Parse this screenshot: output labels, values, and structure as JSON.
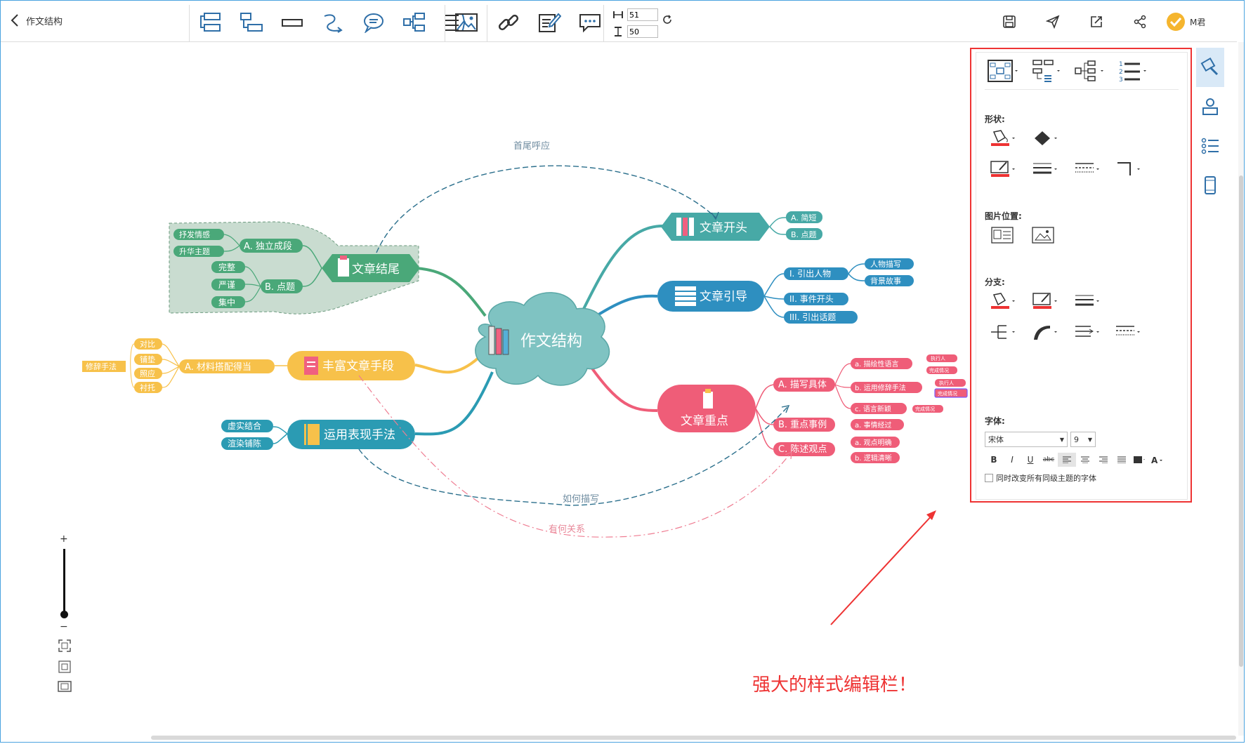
{
  "header": {
    "back_label": "作文结构",
    "zoom_width": "51",
    "zoom_height": "50",
    "user_name": "M君"
  },
  "toolbar_icons": [
    "sibling-topic-icon",
    "child-topic-icon",
    "floating-topic-icon",
    "relationship-icon",
    "callout-icon",
    "summary-icon",
    "boundary-icon",
    "image-icon",
    "link-icon",
    "note-icon",
    "comment-icon"
  ],
  "mindmap": {
    "center": "作文结构",
    "branches": {
      "opening": {
        "title": "文章开头",
        "children": [
          "A. 简短",
          "B. 点题"
        ]
      },
      "intro": {
        "title": "文章引导",
        "children": [
          "I. 引出人物",
          "II. 事件开头",
          "III. 引出话题"
        ],
        "sub": [
          "人物描写",
          "背景故事"
        ]
      },
      "focus": {
        "title": "文章重点",
        "children": [
          "A. 描写具体",
          "B. 重点事例",
          "C. 陈述观点"
        ],
        "desc": [
          "a. 描绘性语言",
          "b. 运用修辞手法",
          "c. 语言新颖"
        ],
        "example": [
          "a. 事情经过"
        ],
        "view": [
          "a. 观点明确",
          "b. 逻辑清晰"
        ],
        "tiny": [
          "执行人",
          "完成情况",
          "执行人",
          "完成情况",
          "完成情况"
        ]
      },
      "ending": {
        "title": "文章结尾",
        "children": [
          "A. 独立成段",
          "B. 点题"
        ],
        "a_sub": [
          "抒发情感",
          "升华主题"
        ],
        "b_sub": [
          "完整",
          "严谨",
          "集中"
        ]
      },
      "rich": {
        "title": "丰富文章手段",
        "children": [
          "A. 材料搭配得当"
        ],
        "sub": [
          "对比",
          "铺垫",
          "照应",
          "衬托"
        ],
        "label": "修辞手法"
      },
      "express": {
        "title": "运用表现手法",
        "sub": [
          "虚实结合",
          "渲染铺陈"
        ]
      }
    },
    "relations": [
      "首尾呼应",
      "如何描写",
      "有何关系"
    ],
    "colors": {
      "center": "#7fc3c2",
      "opening": "#47a9a6",
      "intro": "#2e8fc0",
      "focus": "#ef5d78",
      "ending": "#4aa879",
      "rich": "#f7c14a",
      "express": "#2b9bb3",
      "boundary": "#c9dcd0"
    }
  },
  "panel": {
    "shape_label": "形状:",
    "image_pos_label": "图片位置:",
    "branch_label": "分支:",
    "font_label": "字体:",
    "font_family": "宋体",
    "font_size": "9",
    "format_buttons": [
      "B",
      "I",
      "U",
      "abc"
    ],
    "sync_label": "同时改变所有同级主题的字体"
  },
  "annotation": "强大的样式编辑栏！"
}
